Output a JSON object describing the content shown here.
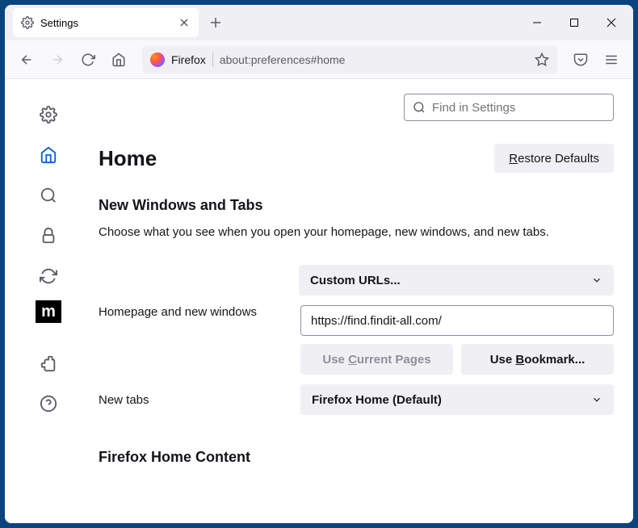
{
  "titlebar": {
    "tab_label": "Settings"
  },
  "navbar": {
    "identity": "Firefox",
    "url": "about:preferences#home"
  },
  "search": {
    "placeholder": "Find in Settings"
  },
  "header": {
    "title": "Home",
    "restore": "Restore Defaults",
    "restore_u": "R"
  },
  "section1": {
    "title": "New Windows and Tabs",
    "sub": "Choose what you see when you open your homepage, new windows, and new tabs."
  },
  "homepage": {
    "label": "Homepage and new windows",
    "select": "Custom URLs...",
    "url": "https://find.findit-all.com/",
    "use_current": "Use Current Pages",
    "use_current_u": "C",
    "use_bookmark": "Use Bookmark...",
    "use_bookmark_u": "B"
  },
  "newtabs": {
    "label": "New tabs",
    "select": "Firefox Home (Default)"
  },
  "section2": {
    "title": "Firefox Home Content"
  }
}
